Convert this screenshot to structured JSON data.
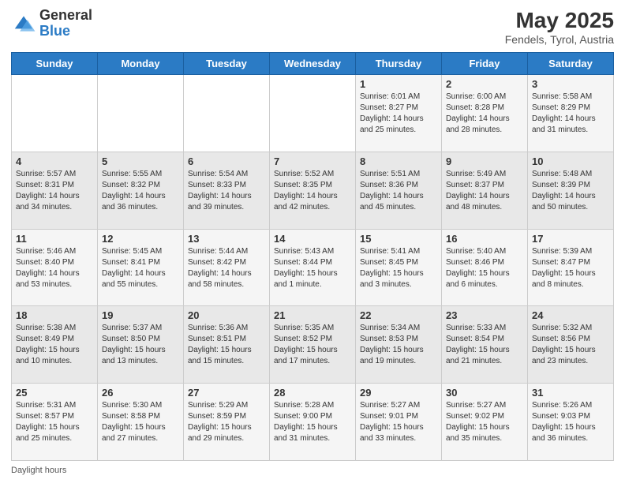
{
  "logo": {
    "general": "General",
    "blue": "Blue"
  },
  "title": "May 2025",
  "subtitle": "Fendels, Tyrol, Austria",
  "days": [
    "Sunday",
    "Monday",
    "Tuesday",
    "Wednesday",
    "Thursday",
    "Friday",
    "Saturday"
  ],
  "weeks": [
    [
      {
        "num": "",
        "lines": []
      },
      {
        "num": "",
        "lines": []
      },
      {
        "num": "",
        "lines": []
      },
      {
        "num": "",
        "lines": []
      },
      {
        "num": "1",
        "lines": [
          "Sunrise: 6:01 AM",
          "Sunset: 8:27 PM",
          "Daylight: 14 hours",
          "and 25 minutes."
        ]
      },
      {
        "num": "2",
        "lines": [
          "Sunrise: 6:00 AM",
          "Sunset: 8:28 PM",
          "Daylight: 14 hours",
          "and 28 minutes."
        ]
      },
      {
        "num": "3",
        "lines": [
          "Sunrise: 5:58 AM",
          "Sunset: 8:29 PM",
          "Daylight: 14 hours",
          "and 31 minutes."
        ]
      }
    ],
    [
      {
        "num": "4",
        "lines": [
          "Sunrise: 5:57 AM",
          "Sunset: 8:31 PM",
          "Daylight: 14 hours",
          "and 34 minutes."
        ]
      },
      {
        "num": "5",
        "lines": [
          "Sunrise: 5:55 AM",
          "Sunset: 8:32 PM",
          "Daylight: 14 hours",
          "and 36 minutes."
        ]
      },
      {
        "num": "6",
        "lines": [
          "Sunrise: 5:54 AM",
          "Sunset: 8:33 PM",
          "Daylight: 14 hours",
          "and 39 minutes."
        ]
      },
      {
        "num": "7",
        "lines": [
          "Sunrise: 5:52 AM",
          "Sunset: 8:35 PM",
          "Daylight: 14 hours",
          "and 42 minutes."
        ]
      },
      {
        "num": "8",
        "lines": [
          "Sunrise: 5:51 AM",
          "Sunset: 8:36 PM",
          "Daylight: 14 hours",
          "and 45 minutes."
        ]
      },
      {
        "num": "9",
        "lines": [
          "Sunrise: 5:49 AM",
          "Sunset: 8:37 PM",
          "Daylight: 14 hours",
          "and 48 minutes."
        ]
      },
      {
        "num": "10",
        "lines": [
          "Sunrise: 5:48 AM",
          "Sunset: 8:39 PM",
          "Daylight: 14 hours",
          "and 50 minutes."
        ]
      }
    ],
    [
      {
        "num": "11",
        "lines": [
          "Sunrise: 5:46 AM",
          "Sunset: 8:40 PM",
          "Daylight: 14 hours",
          "and 53 minutes."
        ]
      },
      {
        "num": "12",
        "lines": [
          "Sunrise: 5:45 AM",
          "Sunset: 8:41 PM",
          "Daylight: 14 hours",
          "and 55 minutes."
        ]
      },
      {
        "num": "13",
        "lines": [
          "Sunrise: 5:44 AM",
          "Sunset: 8:42 PM",
          "Daylight: 14 hours",
          "and 58 minutes."
        ]
      },
      {
        "num": "14",
        "lines": [
          "Sunrise: 5:43 AM",
          "Sunset: 8:44 PM",
          "Daylight: 15 hours",
          "and 1 minute."
        ]
      },
      {
        "num": "15",
        "lines": [
          "Sunrise: 5:41 AM",
          "Sunset: 8:45 PM",
          "Daylight: 15 hours",
          "and 3 minutes."
        ]
      },
      {
        "num": "16",
        "lines": [
          "Sunrise: 5:40 AM",
          "Sunset: 8:46 PM",
          "Daylight: 15 hours",
          "and 6 minutes."
        ]
      },
      {
        "num": "17",
        "lines": [
          "Sunrise: 5:39 AM",
          "Sunset: 8:47 PM",
          "Daylight: 15 hours",
          "and 8 minutes."
        ]
      }
    ],
    [
      {
        "num": "18",
        "lines": [
          "Sunrise: 5:38 AM",
          "Sunset: 8:49 PM",
          "Daylight: 15 hours",
          "and 10 minutes."
        ]
      },
      {
        "num": "19",
        "lines": [
          "Sunrise: 5:37 AM",
          "Sunset: 8:50 PM",
          "Daylight: 15 hours",
          "and 13 minutes."
        ]
      },
      {
        "num": "20",
        "lines": [
          "Sunrise: 5:36 AM",
          "Sunset: 8:51 PM",
          "Daylight: 15 hours",
          "and 15 minutes."
        ]
      },
      {
        "num": "21",
        "lines": [
          "Sunrise: 5:35 AM",
          "Sunset: 8:52 PM",
          "Daylight: 15 hours",
          "and 17 minutes."
        ]
      },
      {
        "num": "22",
        "lines": [
          "Sunrise: 5:34 AM",
          "Sunset: 8:53 PM",
          "Daylight: 15 hours",
          "and 19 minutes."
        ]
      },
      {
        "num": "23",
        "lines": [
          "Sunrise: 5:33 AM",
          "Sunset: 8:54 PM",
          "Daylight: 15 hours",
          "and 21 minutes."
        ]
      },
      {
        "num": "24",
        "lines": [
          "Sunrise: 5:32 AM",
          "Sunset: 8:56 PM",
          "Daylight: 15 hours",
          "and 23 minutes."
        ]
      }
    ],
    [
      {
        "num": "25",
        "lines": [
          "Sunrise: 5:31 AM",
          "Sunset: 8:57 PM",
          "Daylight: 15 hours",
          "and 25 minutes."
        ]
      },
      {
        "num": "26",
        "lines": [
          "Sunrise: 5:30 AM",
          "Sunset: 8:58 PM",
          "Daylight: 15 hours",
          "and 27 minutes."
        ]
      },
      {
        "num": "27",
        "lines": [
          "Sunrise: 5:29 AM",
          "Sunset: 8:59 PM",
          "Daylight: 15 hours",
          "and 29 minutes."
        ]
      },
      {
        "num": "28",
        "lines": [
          "Sunrise: 5:28 AM",
          "Sunset: 9:00 PM",
          "Daylight: 15 hours",
          "and 31 minutes."
        ]
      },
      {
        "num": "29",
        "lines": [
          "Sunrise: 5:27 AM",
          "Sunset: 9:01 PM",
          "Daylight: 15 hours",
          "and 33 minutes."
        ]
      },
      {
        "num": "30",
        "lines": [
          "Sunrise: 5:27 AM",
          "Sunset: 9:02 PM",
          "Daylight: 15 hours",
          "and 35 minutes."
        ]
      },
      {
        "num": "31",
        "lines": [
          "Sunrise: 5:26 AM",
          "Sunset: 9:03 PM",
          "Daylight: 15 hours",
          "and 36 minutes."
        ]
      }
    ]
  ],
  "footer": {
    "daylight_label": "Daylight hours"
  }
}
